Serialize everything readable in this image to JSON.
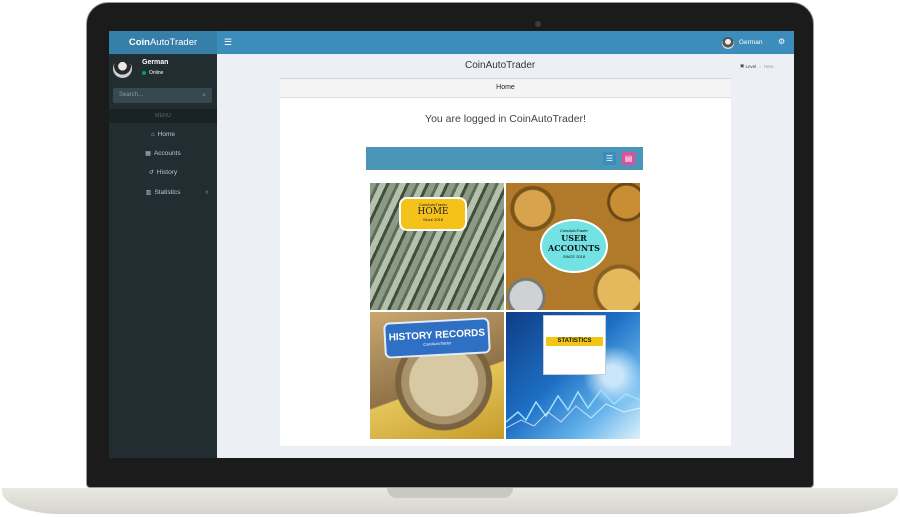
{
  "app": {
    "logo_bold": "Coin",
    "logo_rest": "AutoTrader",
    "toggle_icon": "☰"
  },
  "user": {
    "name": "German",
    "status": "Online"
  },
  "sidebar": {
    "search_placeholder": "Search...",
    "menu_header": "MENU",
    "items": [
      {
        "label": "Home",
        "icon": "home-icon",
        "glyph": "⌂"
      },
      {
        "label": "Accounts",
        "icon": "bank-icon",
        "glyph": "▦"
      },
      {
        "label": "History",
        "icon": "history-icon",
        "glyph": "↺"
      },
      {
        "label": "Statistics",
        "icon": "bar-chart-icon",
        "glyph": "▥"
      }
    ]
  },
  "content": {
    "page_title": "CoinAutoTrader",
    "breadcrumb": [
      "Level",
      "Here"
    ],
    "box_title": "Home",
    "welcome": "You are logged in CoinAutoTrader!"
  },
  "tiles": {
    "home": {
      "top": "CoinAutoTrader",
      "title": "HOME",
      "sub": "Since 2018"
    },
    "accounts": {
      "top": "CoinAutoTrader",
      "title1": "USER",
      "title2": "ACCOUNTS",
      "sub": "SINCE 2018"
    },
    "history": {
      "title": "HISTORY RECORDS",
      "sub": "CoinAutoTrader"
    },
    "stats": {
      "title": "STATISTICS"
    }
  },
  "colors": {
    "header": "#3c8dbc",
    "logo_bg": "#367fa9",
    "sidebar": "#222d32",
    "grid_button": "#d9519f"
  }
}
